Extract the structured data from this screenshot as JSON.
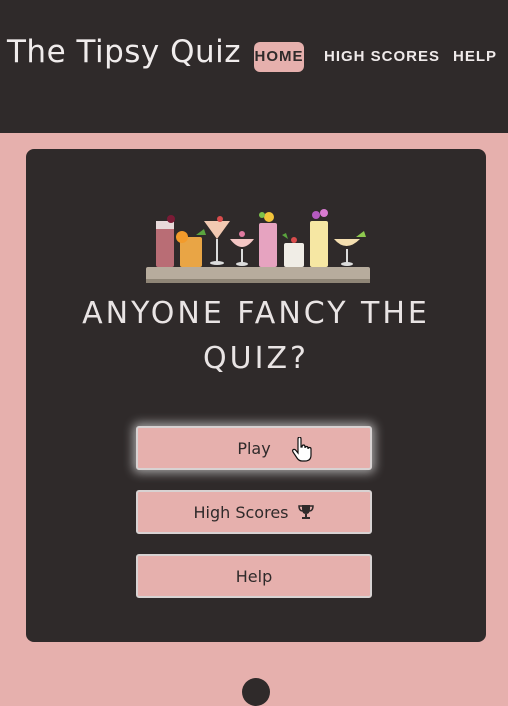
{
  "header": {
    "brand": "The Tipsy Quiz",
    "nav": [
      {
        "label": "HOME",
        "active": true
      },
      {
        "label": "HIGH SCORES",
        "active": false
      },
      {
        "label": "HELP",
        "active": false
      }
    ]
  },
  "main": {
    "headline": "ANYONE FANCY THE QUIZ?",
    "buttons": {
      "play": "Play",
      "high_scores": "High Scores",
      "help": "Help"
    }
  },
  "icons": {
    "trophy": "trophy-icon",
    "cursor": "hand-pointer-icon",
    "hero": "cocktail-glasses-illustration"
  },
  "colors": {
    "dark": "#2f2a2a",
    "pink": "#e6b0ad",
    "text_light": "#efeaea"
  }
}
